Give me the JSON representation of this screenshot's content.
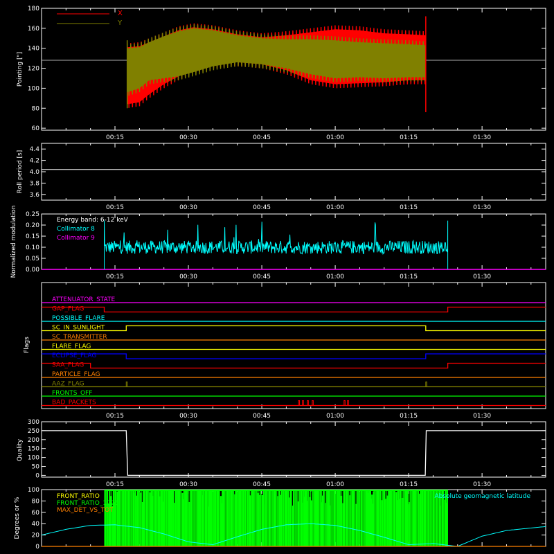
{
  "time_axis": {
    "ticks": [
      "00:15",
      "00:30",
      "00:45",
      "01:00",
      "01:15",
      "01:30"
    ],
    "start_minutes": 0,
    "end_minutes": 103
  },
  "chart_data": [
    {
      "type": "line",
      "ylabel": "Pointing [\"]",
      "ylim": [
        58,
        180
      ],
      "yticks": [
        "60",
        "80",
        "100",
        "120",
        "140",
        "160",
        "180"
      ],
      "legend": [
        {
          "name": "X",
          "color": "#ff0000"
        },
        {
          "name": "Y",
          "color": "#808000"
        }
      ],
      "reference_line": 128,
      "series": [
        {
          "name": "X",
          "color": "#ff0000",
          "x": [
            17.5,
            20,
            22,
            25,
            28,
            31,
            35,
            40,
            45,
            50,
            55,
            60,
            65,
            70,
            75,
            78.5
          ],
          "upper": [
            145,
            146,
            150,
            156,
            162,
            165,
            163,
            158,
            155,
            157,
            160,
            163,
            162,
            159,
            158,
            157
          ],
          "lower": [
            80,
            82,
            90,
            100,
            108,
            115,
            120,
            122,
            120,
            114,
            104,
            100,
            101,
            102,
            104,
            104
          ]
        },
        {
          "name": "Y",
          "color": "#808000",
          "x": [
            17.5,
            20,
            22,
            25,
            28,
            31,
            35,
            40,
            45,
            50,
            55,
            60,
            65,
            70,
            75,
            78.5
          ],
          "upper": [
            144,
            145,
            150,
            156,
            161,
            164,
            162,
            157,
            154,
            153,
            153,
            152,
            150,
            149,
            148,
            147
          ],
          "lower": [
            92,
            96,
            104,
            106,
            108,
            112,
            118,
            122,
            120,
            116,
            110,
            106,
            107,
            106,
            107,
            107
          ]
        }
      ],
      "spikes": [
        {
          "x": 17.5,
          "from": 80,
          "to": 148,
          "color": "#808000"
        },
        {
          "x": 78.5,
          "from": 76,
          "to": 172,
          "color": "#ff0000"
        }
      ]
    },
    {
      "type": "line",
      "ylabel": "Roll period [s]",
      "ylim": [
        3.5,
        4.5
      ],
      "yticks": [
        "3.6",
        "3.8",
        "4.0",
        "4.2",
        "4.4"
      ],
      "series": [
        {
          "x": [
            0,
            103
          ],
          "values": [
            4.04,
            4.04
          ],
          "color": "#ffffff"
        }
      ]
    },
    {
      "type": "line",
      "ylabel": "Normalized modulation",
      "ylim": [
        0,
        0.25
      ],
      "yticks": [
        "0.00",
        "0.05",
        "0.10",
        "0.15",
        "0.20",
        "0.25"
      ],
      "legend_text": [
        {
          "text": "Energy band: 6-12 keV",
          "color": "#ffffff"
        },
        {
          "text": "Collimator 8",
          "color": "#00ffff"
        },
        {
          "text": "Collimator 9",
          "color": "#ff00ff"
        }
      ],
      "series": [
        {
          "name": "Collimator 8",
          "color": "#00ffff",
          "x_start": 12.8,
          "x_end": 83.0,
          "mean": 0.1,
          "spread": 0.03,
          "spike_max": 0.22
        },
        {
          "name": "Collimator 9",
          "color": "#ff00ff",
          "x": [
            0,
            103
          ],
          "values": [
            0,
            0
          ]
        }
      ]
    },
    {
      "type": "line",
      "ylabel": "Flags",
      "flags": [
        {
          "name": "ATTENUATOR_STATE",
          "color": "#ff00ff",
          "steps": [
            [
              0,
              0
            ],
            [
              103,
              0
            ]
          ]
        },
        {
          "name": "GAP_FLAG",
          "color": "#ff0000",
          "steps": [
            [
              0,
              1
            ],
            [
              12.8,
              0
            ],
            [
              83,
              1
            ],
            [
              103,
              1
            ]
          ]
        },
        {
          "name": "POSSIBLE_FLARE",
          "color": "#00ffff",
          "steps": [
            [
              0,
              0
            ],
            [
              103,
              0
            ]
          ]
        },
        {
          "name": "SC_IN_SUNLIGHT",
          "color": "#ffff00",
          "steps": [
            [
              0,
              0
            ],
            [
              17.3,
              1
            ],
            [
              78.5,
              0
            ],
            [
              103,
              0
            ]
          ]
        },
        {
          "name": "SC_TRANSMITTER",
          "color": "#ff8000",
          "steps": [
            [
              0,
              0
            ],
            [
              103,
              0
            ]
          ]
        },
        {
          "name": "FLARE_FLAG",
          "color": "#ffff00",
          "steps": [
            [
              0,
              0
            ],
            [
              103,
              0
            ]
          ]
        },
        {
          "name": "ECLIPSE_FLAG",
          "color": "#0000ff",
          "steps": [
            [
              0,
              1
            ],
            [
              17.3,
              0
            ],
            [
              78.5,
              1
            ],
            [
              103,
              1
            ]
          ]
        },
        {
          "name": "SAA_FLAG",
          "color": "#ff0000",
          "steps": [
            [
              0,
              1
            ],
            [
              10,
              0
            ],
            [
              83,
              1
            ],
            [
              103,
              1
            ]
          ]
        },
        {
          "name": "PARTICLE_FLAG",
          "color": "#ff8000",
          "steps": [
            [
              0,
              0
            ],
            [
              103,
              0
            ]
          ]
        },
        {
          "name": "AAZ_FLAG",
          "color": "#808000",
          "pulses": [
            17.3,
            78.5
          ]
        },
        {
          "name": "FRONTS_OFF",
          "color": "#00ff00",
          "steps": [
            [
              0,
              0
            ],
            [
              103,
              0
            ]
          ]
        },
        {
          "name": "BAD_PACKETS",
          "color": "#ff0000",
          "pulses": [
            52.5,
            53.3,
            54.3,
            55.3,
            61.8,
            62.5
          ]
        }
      ]
    },
    {
      "type": "line",
      "ylabel": "Quality",
      "ylim": [
        -10,
        300
      ],
      "yticks": [
        "0",
        "50",
        "100",
        "150",
        "200",
        "250",
        "300"
      ],
      "series": [
        {
          "color": "#ffffff",
          "x": [
            0,
            17.3,
            17.6,
            78.4,
            78.6,
            103
          ],
          "values": [
            250,
            250,
            0,
            0,
            250,
            250
          ]
        }
      ]
    },
    {
      "type": "line",
      "ylabel": "Degrees or %",
      "ylim": [
        0,
        100
      ],
      "yticks": [
        "0",
        "20",
        "40",
        "60",
        "80",
        "100"
      ],
      "legend_text": [
        {
          "text": "FRONT_RATIO",
          "color": "#ffff00"
        },
        {
          "text": "FRONT_RATIO_1225",
          "color": "#00ff00"
        },
        {
          "text": "MAX_DET_VS_TOT",
          "color": "#ff8000"
        }
      ],
      "right_label": {
        "text": "Absolute geomagnetic latitude",
        "color": "#00ffff"
      },
      "latitude": {
        "color": "#00ffff",
        "x": [
          0,
          5,
          10,
          15,
          20,
          25,
          30,
          35,
          40,
          45,
          50,
          55,
          60,
          65,
          70,
          75,
          80,
          85,
          90,
          95,
          103
        ],
        "values": [
          20,
          30,
          37,
          38,
          33,
          22,
          8,
          3,
          17,
          30,
          38,
          40,
          37,
          28,
          16,
          3,
          5,
          0,
          18,
          28,
          35
        ]
      },
      "ratio_block": {
        "x_start": 12.8,
        "x_end": 83,
        "color": "#00ff00",
        "ymax": 100
      }
    }
  ]
}
